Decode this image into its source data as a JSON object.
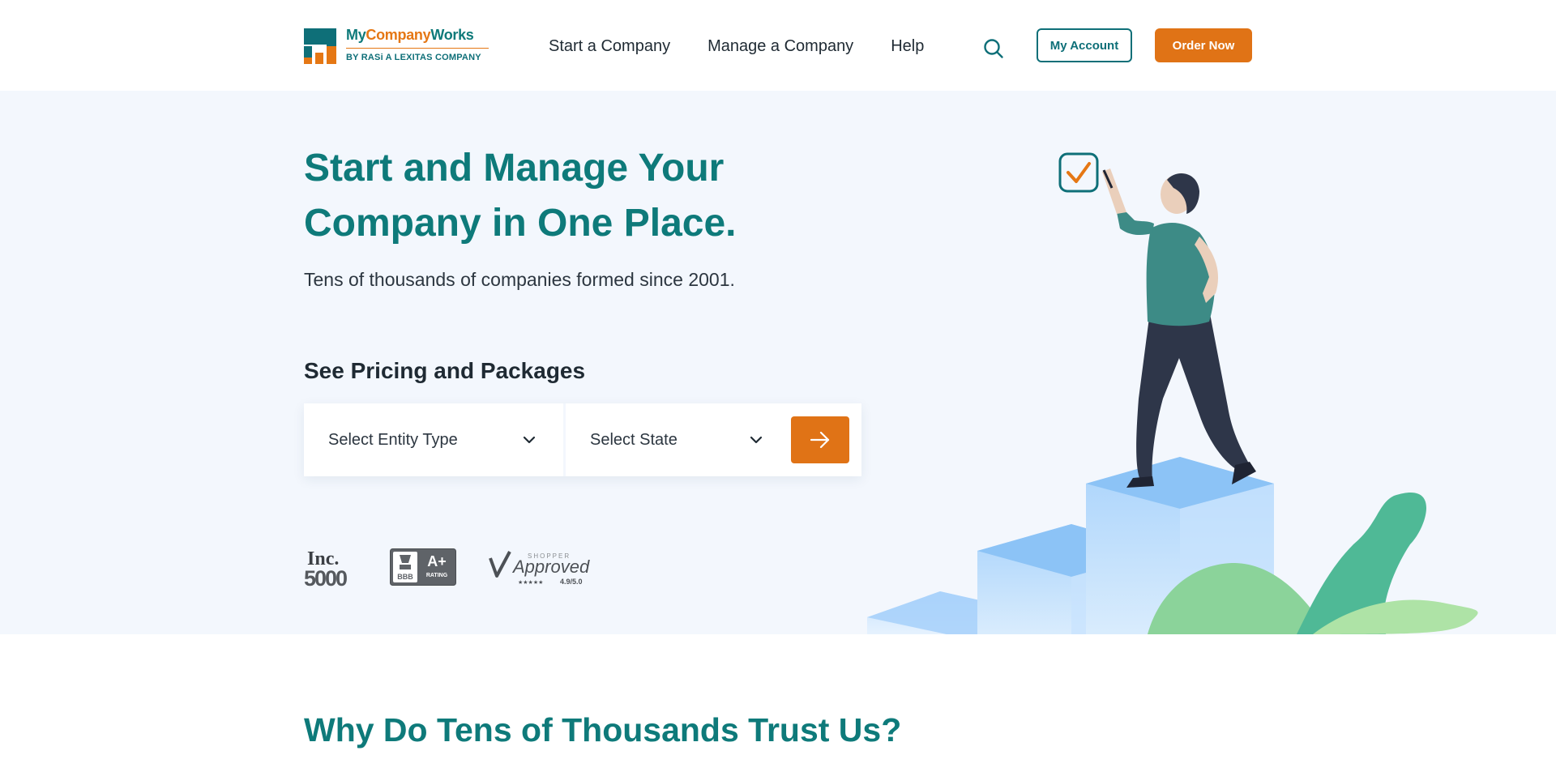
{
  "brand": {
    "logo_part1": "My",
    "logo_part2": "Company",
    "logo_part3": "Works",
    "logo_sub": "BY RASi A LEXITAS COMPANY"
  },
  "nav": {
    "items": [
      {
        "label": "Start a Company"
      },
      {
        "label": "Manage a Company"
      },
      {
        "label": "Help"
      }
    ],
    "search_icon": "search-icon",
    "account_label": "My Account",
    "order_label": "Order Now"
  },
  "hero": {
    "title_line1": "Start and Manage Your",
    "title_line2": "Company in One Place.",
    "subtitle": "Tens of thousands of companies formed since 2001.",
    "pricing_heading": "See Pricing and Packages",
    "entity_select": "Select Entity Type",
    "state_select": "Select State",
    "badges": {
      "inc_top": "Inc.",
      "inc_bottom": "5000",
      "bbb_logo": "BBB",
      "bbb_grade": "A+",
      "bbb_caption": "RATING",
      "sa_top": "SHOPPER",
      "sa_main": "Approved",
      "sa_rating": "4.9/5.0"
    }
  },
  "why": {
    "title": "Why Do Tens of Thousands Trust Us?"
  },
  "colors": {
    "teal": "#0e7a7a",
    "orange": "#e07316",
    "hero_bg": "#f3f7fd"
  }
}
